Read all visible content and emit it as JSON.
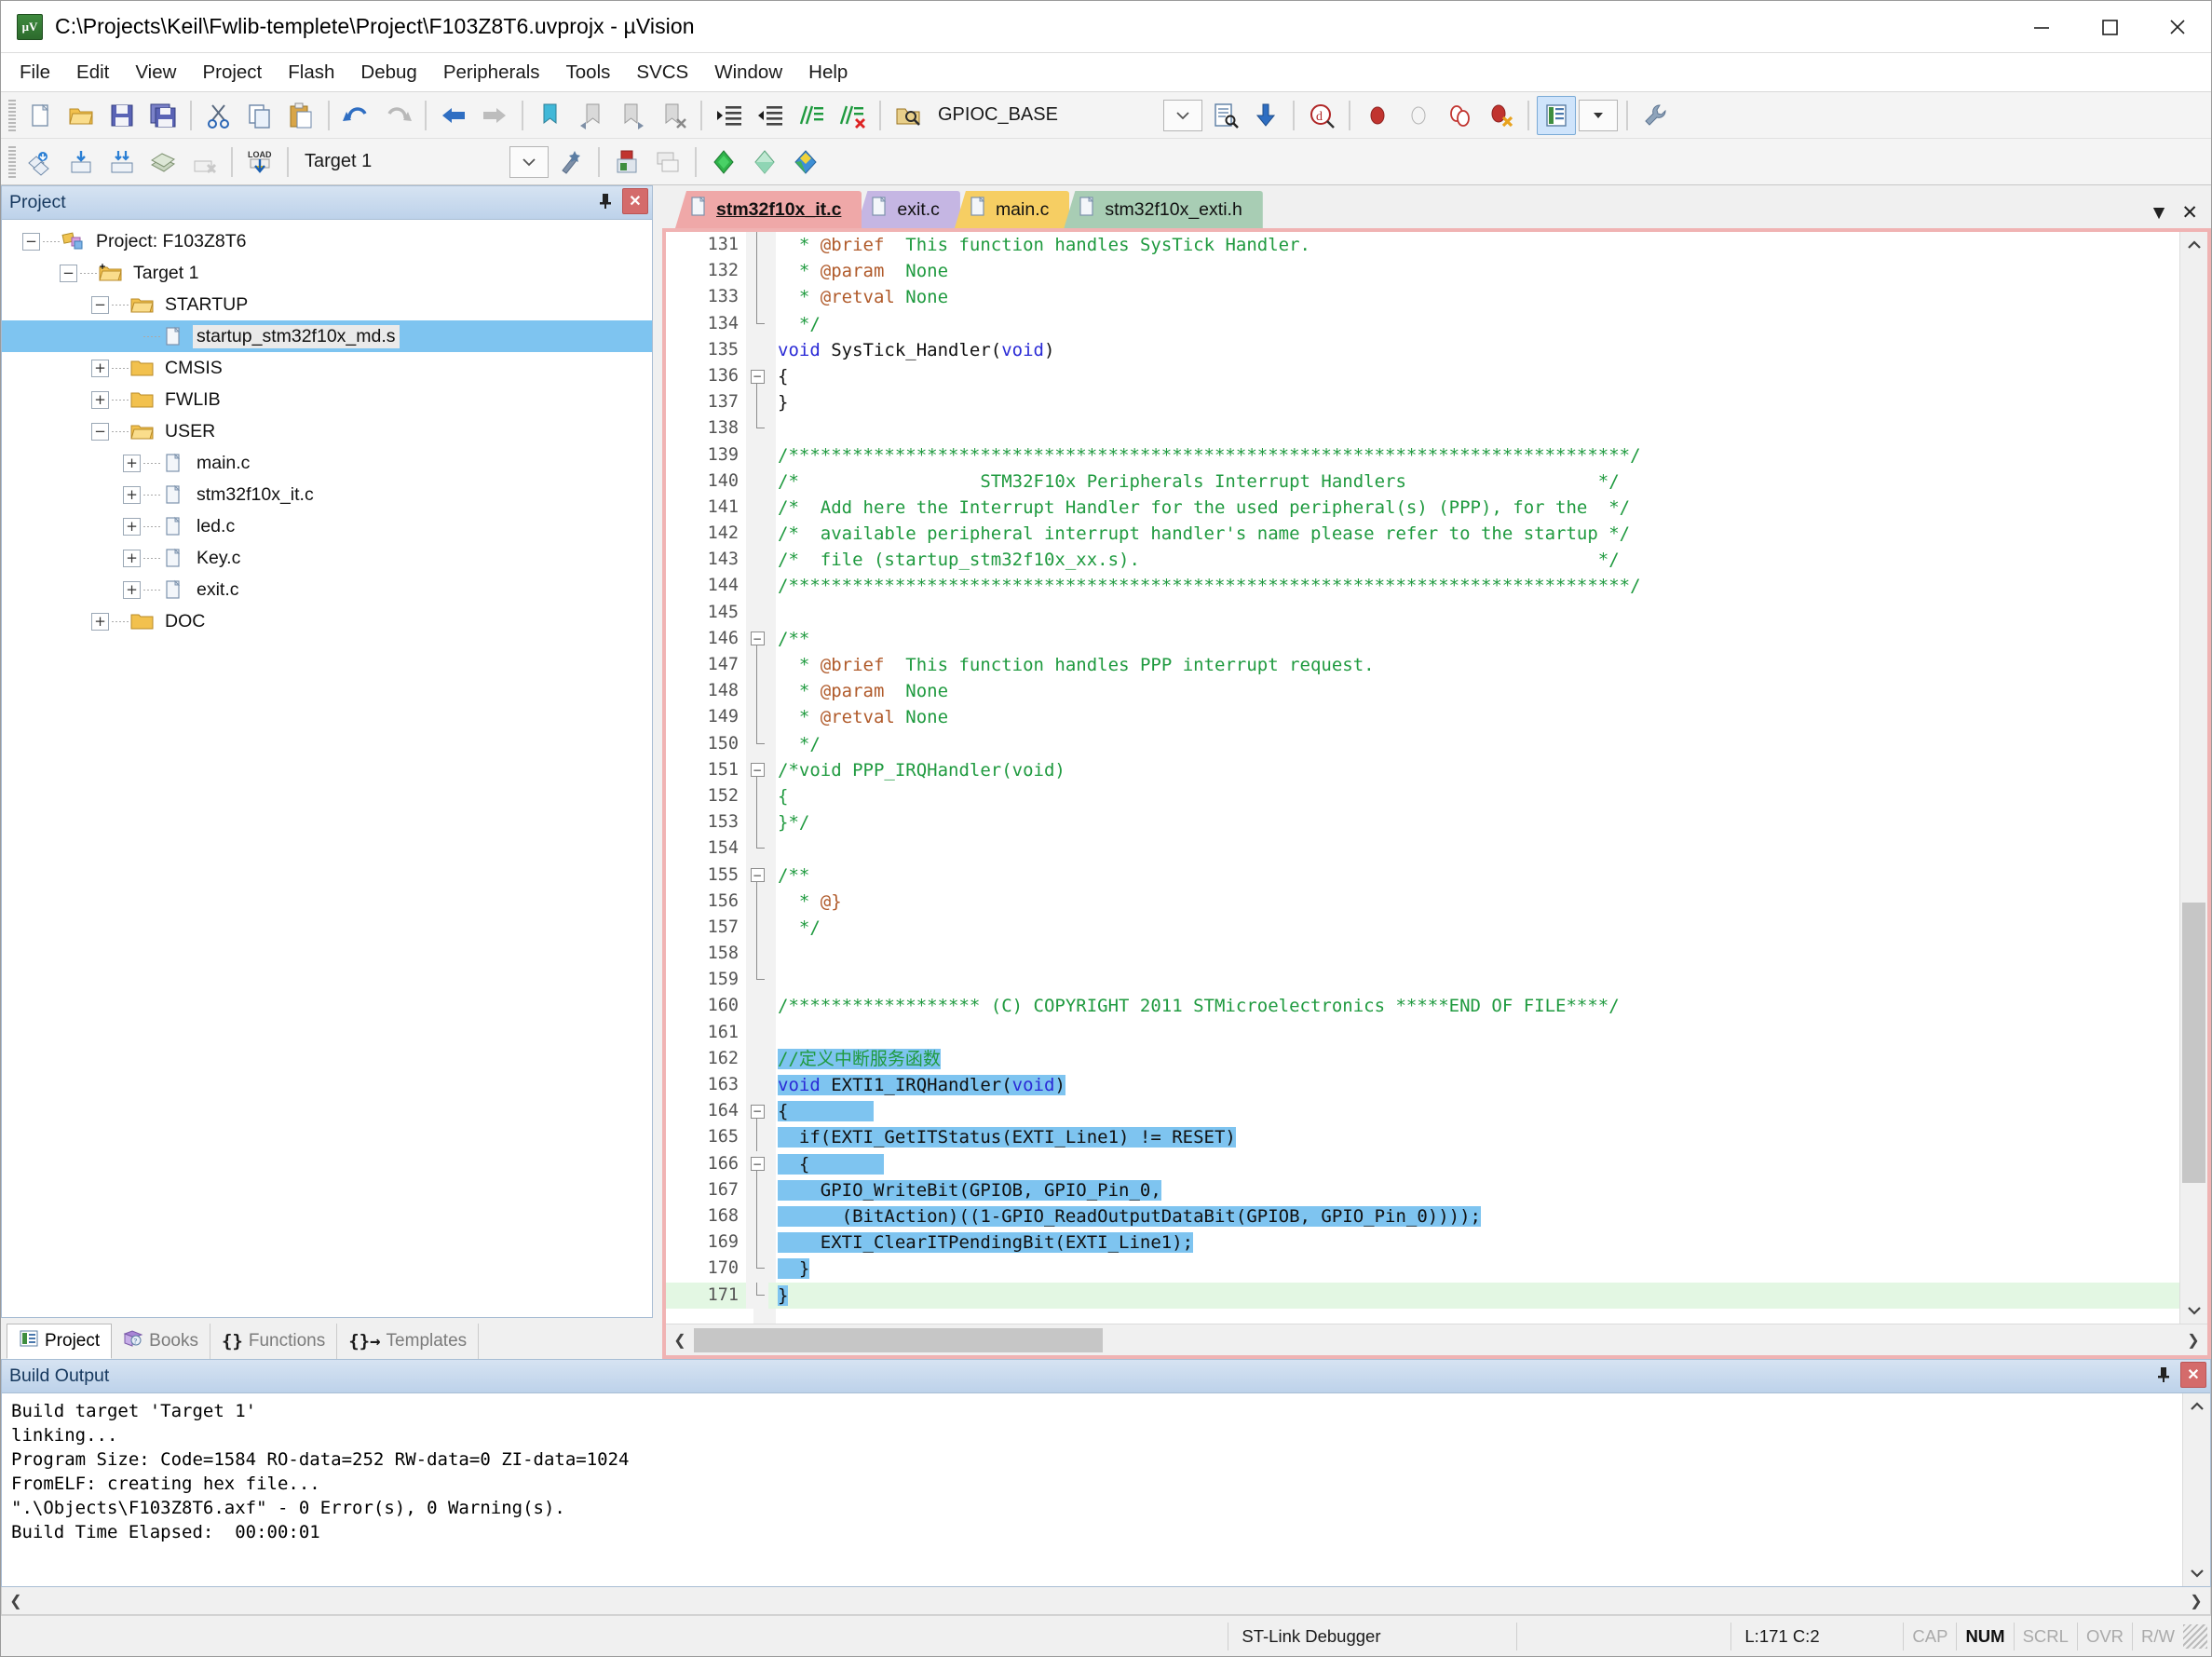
{
  "window": {
    "title": "C:\\Projects\\Keil\\Fwlib-templete\\Project\\F103Z8T6.uvprojx - µVision",
    "app_icon": "uvision-icon",
    "minimize_label": "Minimize",
    "maximize_label": "Maximize",
    "close_label": "Close"
  },
  "menubar": {
    "items": [
      {
        "label": "File"
      },
      {
        "label": "Edit"
      },
      {
        "label": "View"
      },
      {
        "label": "Project"
      },
      {
        "label": "Flash"
      },
      {
        "label": "Debug"
      },
      {
        "label": "Peripherals"
      },
      {
        "label": "Tools"
      },
      {
        "label": "SVCS"
      },
      {
        "label": "Window"
      },
      {
        "label": "Help"
      }
    ]
  },
  "toolbar_main": {
    "buttons": [
      {
        "name": "new-file-icon",
        "tip": "New"
      },
      {
        "name": "open-file-icon",
        "tip": "Open"
      },
      {
        "name": "save-icon",
        "tip": "Save"
      },
      {
        "name": "save-all-icon",
        "tip": "Save All"
      },
      {
        "name": "cut-icon",
        "tip": "Cut"
      },
      {
        "name": "copy-icon",
        "tip": "Copy"
      },
      {
        "name": "paste-icon",
        "tip": "Paste"
      },
      {
        "name": "undo-icon",
        "tip": "Undo"
      },
      {
        "name": "redo-icon",
        "tip": "Redo"
      },
      {
        "name": "navigate-back-icon",
        "tip": "Back"
      },
      {
        "name": "navigate-forward-icon",
        "tip": "Forward"
      },
      {
        "name": "bookmark-toggle-icon",
        "tip": "Insert/Remove Bookmark"
      },
      {
        "name": "bookmark-prev-icon",
        "tip": "Previous Bookmark"
      },
      {
        "name": "bookmark-next-icon",
        "tip": "Next Bookmark"
      },
      {
        "name": "bookmark-clear-icon",
        "tip": "Clear All Bookmarks"
      },
      {
        "name": "indent-right-icon",
        "tip": "Indent"
      },
      {
        "name": "indent-left-icon",
        "tip": "Outdent"
      },
      {
        "name": "comment-icon",
        "tip": "Comment"
      },
      {
        "name": "uncomment-icon",
        "tip": "Uncomment"
      }
    ],
    "symbol_search_value": "GPIOC_BASE",
    "symbol_search_placeholder": "",
    "right_buttons": [
      {
        "name": "find-in-files-icon",
        "tip": "Find in Files"
      },
      {
        "name": "goto-definition-icon",
        "tip": "Go To Definition"
      },
      {
        "name": "start-debug-icon",
        "tip": "Start/Stop Debug Session"
      },
      {
        "name": "breakpoint-insert-icon",
        "tip": "Insert/Remove Breakpoint"
      },
      {
        "name": "breakpoint-enable-icon",
        "tip": "Enable/Disable Breakpoint"
      },
      {
        "name": "breakpoint-disable-all-icon",
        "tip": "Disable All Breakpoints"
      },
      {
        "name": "breakpoint-kill-all-icon",
        "tip": "Kill All Breakpoints"
      },
      {
        "name": "manage-windows-icon",
        "tip": "Manage Component Windows",
        "active": true
      },
      {
        "name": "configure-icon",
        "tip": "Configuration Wizard"
      }
    ]
  },
  "toolbar_build": {
    "buttons": [
      {
        "name": "translate-icon",
        "tip": "Translate"
      },
      {
        "name": "build-icon",
        "tip": "Build"
      },
      {
        "name": "rebuild-icon",
        "tip": "Rebuild"
      },
      {
        "name": "batch-build-icon",
        "tip": "Batch Build"
      },
      {
        "name": "stop-build-icon",
        "tip": "Stop Build"
      },
      {
        "name": "download-icon",
        "tip": "Download"
      }
    ],
    "target_value": "Target 1",
    "after_buttons": [
      {
        "name": "target-options-icon",
        "tip": "Target Options"
      },
      {
        "name": "manage-project-items-icon",
        "tip": "Manage Project Items"
      },
      {
        "name": "manage-run-time-icon",
        "tip": "Manage Run-Time Environment"
      },
      {
        "name": "pack-installer-icon",
        "tip": "Pack Installer"
      },
      {
        "name": "multi-project-icon",
        "tip": "Multi-Project"
      },
      {
        "name": "select-software-packs-icon",
        "tip": "Select Software Packs"
      }
    ]
  },
  "project_panel": {
    "title": "Project",
    "pin_label": "Auto Hide",
    "close_label": "Close",
    "tree": [
      {
        "label": "Project: F103Z8T6",
        "depth": 0,
        "state": "minus",
        "icon": "project-icon",
        "selected": false
      },
      {
        "label": "Target 1",
        "depth": 1,
        "state": "minus",
        "icon": "target-icon",
        "selected": false
      },
      {
        "label": "STARTUP",
        "depth": 2,
        "state": "minus",
        "icon": "folder-open-icon",
        "selected": false
      },
      {
        "label": "startup_stm32f10x_md.s",
        "depth": 3,
        "state": "none",
        "icon": "file-icon",
        "selected": true
      },
      {
        "label": "CMSIS",
        "depth": 2,
        "state": "plus",
        "icon": "folder-icon",
        "selected": false
      },
      {
        "label": "FWLIB",
        "depth": 2,
        "state": "plus",
        "icon": "folder-icon",
        "selected": false
      },
      {
        "label": "USER",
        "depth": 2,
        "state": "minus",
        "icon": "folder-open-icon",
        "selected": false
      },
      {
        "label": "main.c",
        "depth": 3,
        "state": "plus",
        "icon": "file-icon",
        "selected": false
      },
      {
        "label": "stm32f10x_it.c",
        "depth": 3,
        "state": "plus",
        "icon": "file-icon",
        "selected": false
      },
      {
        "label": "led.c",
        "depth": 3,
        "state": "plus",
        "icon": "file-icon",
        "selected": false
      },
      {
        "label": "Key.c",
        "depth": 3,
        "state": "plus",
        "icon": "file-icon",
        "selected": false
      },
      {
        "label": "exit.c",
        "depth": 3,
        "state": "plus",
        "icon": "file-icon",
        "selected": false
      },
      {
        "label": "DOC",
        "depth": 2,
        "state": "plus",
        "icon": "folder-icon",
        "selected": false
      }
    ],
    "bottom_tabs": [
      {
        "label": "Project",
        "icon": "project-tab-icon",
        "active": true
      },
      {
        "label": "Books",
        "icon": "books-tab-icon",
        "active": false
      },
      {
        "label": "Functions",
        "icon": "functions-tab-icon",
        "active": false
      },
      {
        "label": "Templates",
        "icon": "templates-tab-icon",
        "active": false
      }
    ]
  },
  "editor": {
    "tabs": [
      {
        "label": "stm32f10x_it.c",
        "color": "#efa8a8",
        "active": true
      },
      {
        "label": "exit.c",
        "color": "#c5b6e3",
        "active": false
      },
      {
        "label": "main.c",
        "color": "#f6ce63",
        "active": false
      },
      {
        "label": "stm32f10x_exti.h",
        "color": "#a8cdb4",
        "active": false
      }
    ],
    "tabbar_menu_label": "Window List",
    "tabbar_close_label": "Close Document",
    "first_line": 131,
    "lines": [
      {
        "n": 131,
        "fold": "bar",
        "segs": [
          {
            "t": "  * ",
            "c": "cmt"
          },
          {
            "t": "@brief",
            "c": "tag"
          },
          {
            "t": "  This function handles SysTick Handler.",
            "c": "cmt"
          }
        ]
      },
      {
        "n": 132,
        "fold": "bar",
        "segs": [
          {
            "t": "  * ",
            "c": "cmt"
          },
          {
            "t": "@param",
            "c": "tag"
          },
          {
            "t": "  None",
            "c": "cmt"
          }
        ]
      },
      {
        "n": 133,
        "fold": "bar",
        "segs": [
          {
            "t": "  * ",
            "c": "cmt"
          },
          {
            "t": "@retval",
            "c": "tag"
          },
          {
            "t": " None",
            "c": "cmt"
          }
        ]
      },
      {
        "n": 134,
        "fold": "end",
        "segs": [
          {
            "t": "  */",
            "c": "cmt"
          }
        ]
      },
      {
        "n": 135,
        "fold": "none",
        "segs": [
          {
            "t": "void",
            "c": "kw"
          },
          {
            "t": " SysTick_Handler(",
            "c": "txt"
          },
          {
            "t": "void",
            "c": "kw"
          },
          {
            "t": ")",
            "c": "txt"
          }
        ]
      },
      {
        "n": 136,
        "fold": "minus",
        "segs": [
          {
            "t": "{",
            "c": "txt"
          }
        ]
      },
      {
        "n": 137,
        "fold": "bar",
        "segs": [
          {
            "t": "}",
            "c": "txt"
          }
        ]
      },
      {
        "n": 138,
        "fold": "end",
        "segs": []
      },
      {
        "n": 139,
        "fold": "none",
        "segs": [
          {
            "t": "/*******************************************************************************/",
            "c": "cmt"
          }
        ]
      },
      {
        "n": 140,
        "fold": "none",
        "segs": [
          {
            "t": "/*                 STM32F10x Peripherals Interrupt Handlers                  */",
            "c": "cmt"
          }
        ]
      },
      {
        "n": 141,
        "fold": "none",
        "segs": [
          {
            "t": "/*  Add here the Interrupt Handler for the used peripheral(s) (PPP), for the  */",
            "c": "cmt"
          }
        ]
      },
      {
        "n": 142,
        "fold": "none",
        "segs": [
          {
            "t": "/*  available peripheral interrupt handler's name please refer to the startup */",
            "c": "cmt"
          }
        ]
      },
      {
        "n": 143,
        "fold": "none",
        "segs": [
          {
            "t": "/*  file (startup_stm32f10x_xx.s).                                           */",
            "c": "cmt"
          }
        ]
      },
      {
        "n": 144,
        "fold": "none",
        "segs": [
          {
            "t": "/*******************************************************************************/",
            "c": "cmt"
          }
        ]
      },
      {
        "n": 145,
        "fold": "none",
        "segs": []
      },
      {
        "n": 146,
        "fold": "minus",
        "segs": [
          {
            "t": "/**",
            "c": "cmt"
          }
        ]
      },
      {
        "n": 147,
        "fold": "bar",
        "segs": [
          {
            "t": "  * ",
            "c": "cmt"
          },
          {
            "t": "@brief",
            "c": "tag"
          },
          {
            "t": "  This function handles PPP interrupt request.",
            "c": "cmt"
          }
        ]
      },
      {
        "n": 148,
        "fold": "bar",
        "segs": [
          {
            "t": "  * ",
            "c": "cmt"
          },
          {
            "t": "@param",
            "c": "tag"
          },
          {
            "t": "  None",
            "c": "cmt"
          }
        ]
      },
      {
        "n": 149,
        "fold": "bar",
        "segs": [
          {
            "t": "  * ",
            "c": "cmt"
          },
          {
            "t": "@retval",
            "c": "tag"
          },
          {
            "t": " None",
            "c": "cmt"
          }
        ]
      },
      {
        "n": 150,
        "fold": "end",
        "segs": [
          {
            "t": "  */",
            "c": "cmt"
          }
        ]
      },
      {
        "n": 151,
        "fold": "minus",
        "segs": [
          {
            "t": "/*void PPP_IRQHandler(void)",
            "c": "cmt"
          }
        ]
      },
      {
        "n": 152,
        "fold": "bar",
        "segs": [
          {
            "t": "{",
            "c": "cmt"
          }
        ]
      },
      {
        "n": 153,
        "fold": "bar",
        "segs": [
          {
            "t": "}*/",
            "c": "cmt"
          }
        ]
      },
      {
        "n": 154,
        "fold": "end",
        "segs": []
      },
      {
        "n": 155,
        "fold": "minus",
        "segs": [
          {
            "t": "/**",
            "c": "cmt"
          }
        ]
      },
      {
        "n": 156,
        "fold": "bar",
        "segs": [
          {
            "t": "  * ",
            "c": "cmt"
          },
          {
            "t": "@}",
            "c": "tag"
          }
        ]
      },
      {
        "n": 157,
        "fold": "bar",
        "segs": [
          {
            "t": "  */",
            "c": "cmt"
          }
        ]
      },
      {
        "n": 158,
        "fold": "bar",
        "segs": []
      },
      {
        "n": 159,
        "fold": "end",
        "segs": []
      },
      {
        "n": 160,
        "fold": "none",
        "segs": [
          {
            "t": "/****************** (C) COPYRIGHT 2011 STMicroelectronics *****END OF FILE****/",
            "c": "cmt"
          }
        ]
      },
      {
        "n": 161,
        "fold": "none",
        "segs": []
      },
      {
        "n": 162,
        "fold": "none",
        "segs": [
          {
            "t": "//定义中断服务函数",
            "c": "cmt",
            "sel": true
          }
        ]
      },
      {
        "n": 163,
        "fold": "none",
        "segs": [
          {
            "t": "void",
            "c": "kw",
            "sel": true
          },
          {
            "t": " EXTI1_IRQHandler(",
            "c": "txt",
            "sel": true
          },
          {
            "t": "void",
            "c": "kw",
            "sel": true
          },
          {
            "t": ")",
            "c": "txt",
            "sel": true
          }
        ]
      },
      {
        "n": 164,
        "fold": "minus",
        "segs": [
          {
            "t": "{",
            "c": "txt",
            "sel": true
          },
          {
            "t": "        ",
            "c": "txt",
            "sel": true
          }
        ]
      },
      {
        "n": 165,
        "fold": "bar",
        "segs": [
          {
            "t": "  if(EXTI_GetITStatus(EXTI_Line1) != RESET)",
            "c": "txt",
            "sel": true
          }
        ]
      },
      {
        "n": 166,
        "fold": "minus2",
        "segs": [
          {
            "t": "  {",
            "c": "txt",
            "sel": true
          },
          {
            "t": "       ",
            "c": "txt",
            "sel": true
          }
        ]
      },
      {
        "n": 167,
        "fold": "bar2",
        "segs": [
          {
            "t": "    GPIO_WriteBit(GPIOB, GPIO_Pin_0,",
            "c": "txt",
            "sel": true
          }
        ]
      },
      {
        "n": 168,
        "fold": "bar2",
        "segs": [
          {
            "t": "      (BitAction)((1-GPIO_ReadOutputDataBit(GPIOB, GPIO_Pin_0))));",
            "c": "txt",
            "sel": true
          }
        ]
      },
      {
        "n": 169,
        "fold": "bar2",
        "segs": [
          {
            "t": "    EXTI_ClearITPendingBit(EXTI_Line1);",
            "c": "txt",
            "sel": true
          }
        ]
      },
      {
        "n": 170,
        "fold": "end2",
        "segs": [
          {
            "t": "  }",
            "c": "txt",
            "sel": true
          }
        ]
      },
      {
        "n": 171,
        "fold": "end",
        "current": true,
        "segs": [
          {
            "t": "}",
            "c": "txt",
            "sel": true
          }
        ]
      }
    ]
  },
  "build_output": {
    "title": "Build Output",
    "pin_label": "Auto Hide",
    "close_label": "Close",
    "text": "Build target 'Target 1'\nlinking...\nProgram Size: Code=1584 RO-data=252 RW-data=0 ZI-data=1024\nFromELF: creating hex file...\n\".\\Objects\\F103Z8T6.axf\" - 0 Error(s), 0 Warning(s).\nBuild Time Elapsed:  00:00:01"
  },
  "statusbar": {
    "debugger": "ST-Link Debugger",
    "cursor": "L:171 C:2",
    "indicators": [
      {
        "label": "CAP",
        "on": false
      },
      {
        "label": "NUM",
        "on": true
      },
      {
        "label": "SCRL",
        "on": false
      },
      {
        "label": "OVR",
        "on": false
      },
      {
        "label": "R/W",
        "on": false
      }
    ]
  },
  "colors": {
    "comment": "#1f9a3f",
    "doc_tag": "#b05a2a",
    "keyword": "#2a2ad6",
    "plain": "#101010",
    "selection": "#7ec4f0",
    "current_line": "#e3f7e3",
    "panel_header": "#bdd2ea",
    "editor_frame": "#f0b3b3"
  }
}
